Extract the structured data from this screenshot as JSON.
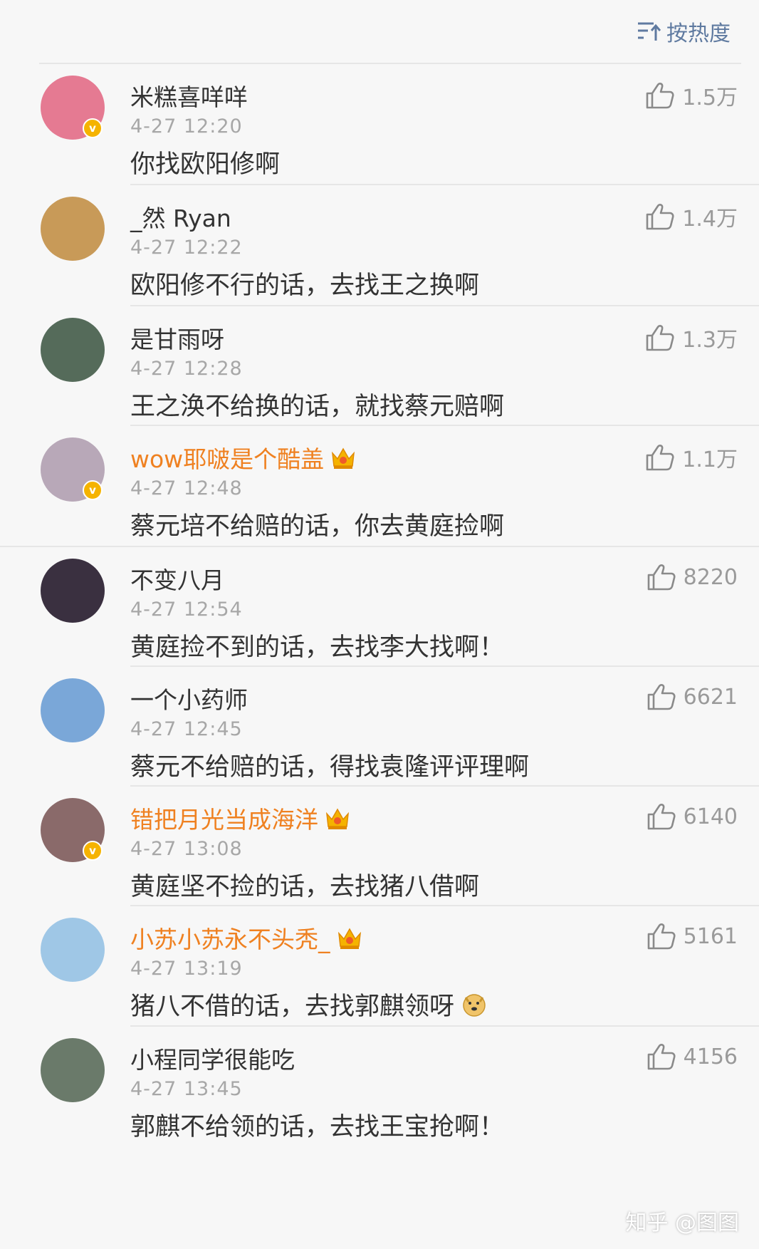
{
  "sort": {
    "label": "按热度",
    "icon": "sort-hot-icon"
  },
  "comments": [
    {
      "name": "米糕喜咩咩",
      "time": "4-27 12:20",
      "text": "你找欧阳修啊",
      "likes": "1.5万",
      "vip": false,
      "verified": true,
      "avatar_color": "#e57a92"
    },
    {
      "name": "_然 Ryan",
      "time": "4-27 12:22",
      "text": "欧阳修不行的话，去找王之换啊",
      "likes": "1.4万",
      "vip": false,
      "verified": false,
      "avatar_color": "#c89a58"
    },
    {
      "name": "是甘雨呀",
      "time": "4-27 12:28",
      "text": "王之涣不给换的话，就找蔡元赔啊",
      "likes": "1.3万",
      "vip": false,
      "verified": false,
      "avatar_color": "#556b5a"
    },
    {
      "name": "wow耶啵是个酷盖",
      "time": "4-27 12:48",
      "text": "蔡元培不给赔的话，你去黄庭捡啊",
      "likes": "1.1万",
      "vip": true,
      "verified": true,
      "avatar_color": "#b8a8b8"
    },
    {
      "name": "不变八月",
      "time": "4-27 12:54",
      "text": "黄庭捡不到的话，去找李大找啊！",
      "likes": "8220",
      "vip": false,
      "verified": false,
      "avatar_color": "#3a3040"
    },
    {
      "name": "一个小药师",
      "time": "4-27 12:45",
      "text": "蔡元不给赔的话，得找袁隆评评理啊",
      "likes": "6621",
      "vip": false,
      "verified": false,
      "avatar_color": "#7aa7d8"
    },
    {
      "name": "错把月光当成海洋",
      "time": "4-27 13:08",
      "text": "黄庭坚不捡的话，去找猪八借啊",
      "likes": "6140",
      "vip": true,
      "verified": true,
      "avatar_color": "#8a6a6a"
    },
    {
      "name": "小苏小苏永不头秃_",
      "time": "4-27 13:19",
      "text": "猪八不借的话，去找郭麒领呀",
      "likes": "5161",
      "vip": true,
      "verified": false,
      "avatar_color": "#9fc7e6",
      "emoji": "doge-emoji"
    },
    {
      "name": "小程同学很能吃",
      "time": "4-27 13:45",
      "text": "郭麒不给领的话，去找王宝抢啊！",
      "likes": "4156",
      "vip": false,
      "verified": false,
      "avatar_color": "#6a7a6a"
    }
  ],
  "watermark": "知乎 @图图"
}
